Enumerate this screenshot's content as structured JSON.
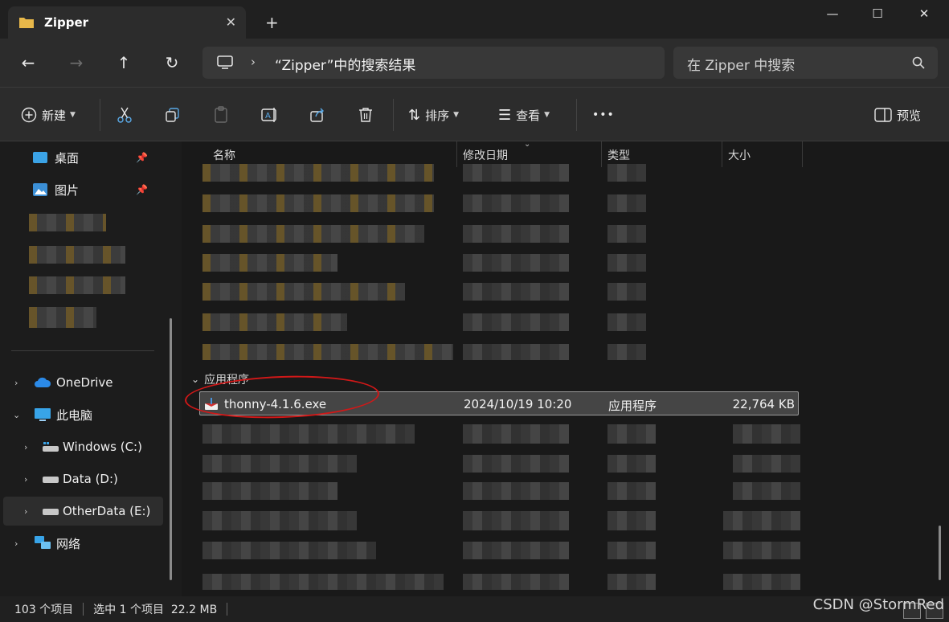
{
  "window": {
    "tab_title": "Zipper",
    "new_tab": "+",
    "minimize": "—",
    "maximize": "☐",
    "close": "✕"
  },
  "address": {
    "path": "“Zipper”中的搜索结果",
    "search_placeholder": "在 Zipper 中搜索"
  },
  "toolbar": {
    "new_label": "新建",
    "sort_label": "排序",
    "view_label": "查看",
    "more_label": "•••",
    "preview_label": "预览"
  },
  "sidebar": {
    "desktop": "桌面",
    "pictures": "图片",
    "onedrive": "OneDrive",
    "this_pc": "此电脑",
    "drive_c": "Windows (C:)",
    "drive_d": "Data (D:)",
    "drive_e": "OtherData (E:)",
    "network": "网络"
  },
  "columns": {
    "name": "名称",
    "modified": "修改日期",
    "type": "类型",
    "size": "大小"
  },
  "group": {
    "label": "应用程序"
  },
  "selected_file": {
    "name": "thonny-4.1.6.exe",
    "modified": "2024/10/19 10:20",
    "type": "应用程序",
    "size": "22,764 KB"
  },
  "status": {
    "count": "103 个项目",
    "selection": "选中 1 个项目  22.2 MB"
  },
  "watermark": "CSDN @StormRed",
  "colors": {
    "accent_red": "#d01818",
    "folder_gold": "#e8b84a"
  }
}
